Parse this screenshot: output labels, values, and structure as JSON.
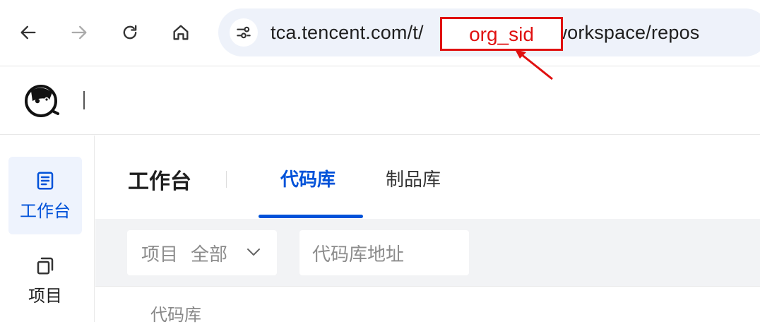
{
  "browser": {
    "url_prefix": "tca.tencent.com/t/",
    "url_suffix": "/workspace/repos",
    "redaction_label": "org_sid",
    "colors": {
      "redaction": "#e01010",
      "address_bar": "#eef2fa"
    },
    "icons": [
      "back-arrow-icon",
      "forward-arrow-icon",
      "reload-icon",
      "home-icon",
      "site-settings-icon"
    ]
  },
  "sidebar": {
    "items": [
      {
        "label": "工作台",
        "icon": "workbench-icon",
        "active": true
      },
      {
        "label": "项目",
        "icon": "project-icon",
        "active": false
      }
    ]
  },
  "main": {
    "title": "工作台",
    "tabs": [
      {
        "label": "代码库",
        "active": true
      },
      {
        "label": "制品库",
        "active": false
      }
    ],
    "filters": {
      "project_label": "项目",
      "project_value": "全部",
      "repo_placeholder": "代码库地址"
    },
    "table": {
      "column_header": "代码库"
    }
  },
  "colors": {
    "accent": "#0052d9",
    "filter_bg": "#f2f3f5"
  }
}
